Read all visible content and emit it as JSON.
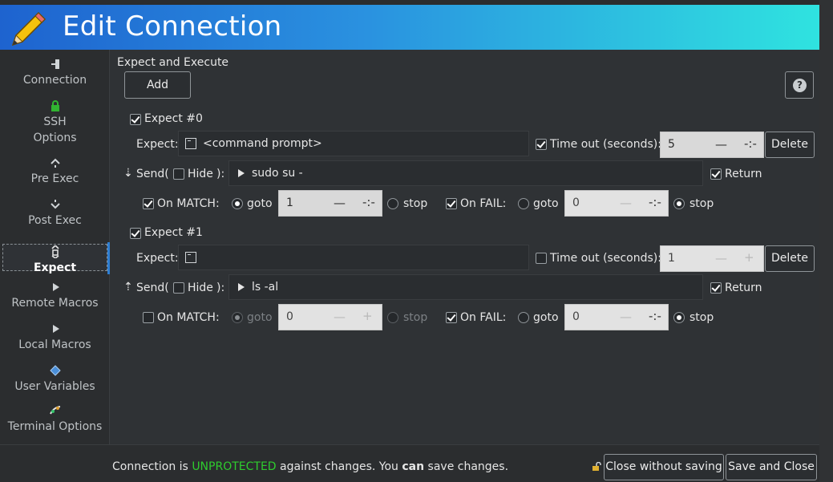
{
  "window": {
    "title": "Edit Connection"
  },
  "sidebar": {
    "items": [
      {
        "label": "Connection",
        "icon": "connection-plug-icon"
      },
      {
        "label": "SSH",
        "label2": "Options",
        "icon": "lock-icon"
      },
      {
        "label": "Pre Exec",
        "icon": "pre-exec-icon"
      },
      {
        "label": "Post Exec",
        "icon": "post-exec-icon"
      },
      {
        "label": "Expect",
        "icon": "expect-icon",
        "active": true
      },
      {
        "label": "Remote Macros",
        "icon": "play-icon"
      },
      {
        "label": "Local Macros",
        "icon": "play-icon"
      },
      {
        "label": "User Variables",
        "icon": "diamond-icon"
      },
      {
        "label": "Terminal Options",
        "icon": "terminal-options-icon"
      }
    ]
  },
  "main": {
    "section_title": "Expect and Execute",
    "add_label": "Add",
    "help_glyph": "?",
    "labels": {
      "expect": "Expect:",
      "timeout": "Time out (seconds):",
      "delete": "Delete",
      "send_open": "Send(",
      "hide": "Hide",
      "send_close": "):",
      "return": "Return",
      "on_match": "On MATCH:",
      "goto": "goto",
      "stop": "stop",
      "on_fail": "On FAIL:"
    },
    "expects": [
      {
        "title": "Expect #0",
        "enabled": true,
        "expect_value": "<command prompt>",
        "timeout_enabled": true,
        "timeout_value": "5",
        "send_value": "sudo su -",
        "hide": false,
        "return": true,
        "on_match_enabled": true,
        "on_match_action": "goto",
        "on_match_goto": "1",
        "on_fail_enabled": true,
        "on_fail_action": "stop",
        "on_fail_goto": "0"
      },
      {
        "title": "Expect #1",
        "enabled": true,
        "expect_value": "",
        "timeout_enabled": false,
        "timeout_value": "1",
        "send_value": "ls -al",
        "hide": false,
        "return": true,
        "on_match_enabled": false,
        "on_match_action": "goto",
        "on_match_goto": "0",
        "on_fail_enabled": true,
        "on_fail_action": "stop",
        "on_fail_goto": "0"
      }
    ]
  },
  "footer": {
    "msg_prefix": "Connection is ",
    "msg_status": "UNPROTECTED",
    "msg_middle": " against changes. You ",
    "msg_can": "can",
    "msg_suffix": " save changes.",
    "close_without_saving": "Close without saving",
    "save_and_close": "Save and Close"
  },
  "colors": {
    "status_unprotected": "#2ecc2e",
    "header_start": "#1e63cf",
    "header_end": "#2fe3e0",
    "accent": "#2f7fd3"
  }
}
